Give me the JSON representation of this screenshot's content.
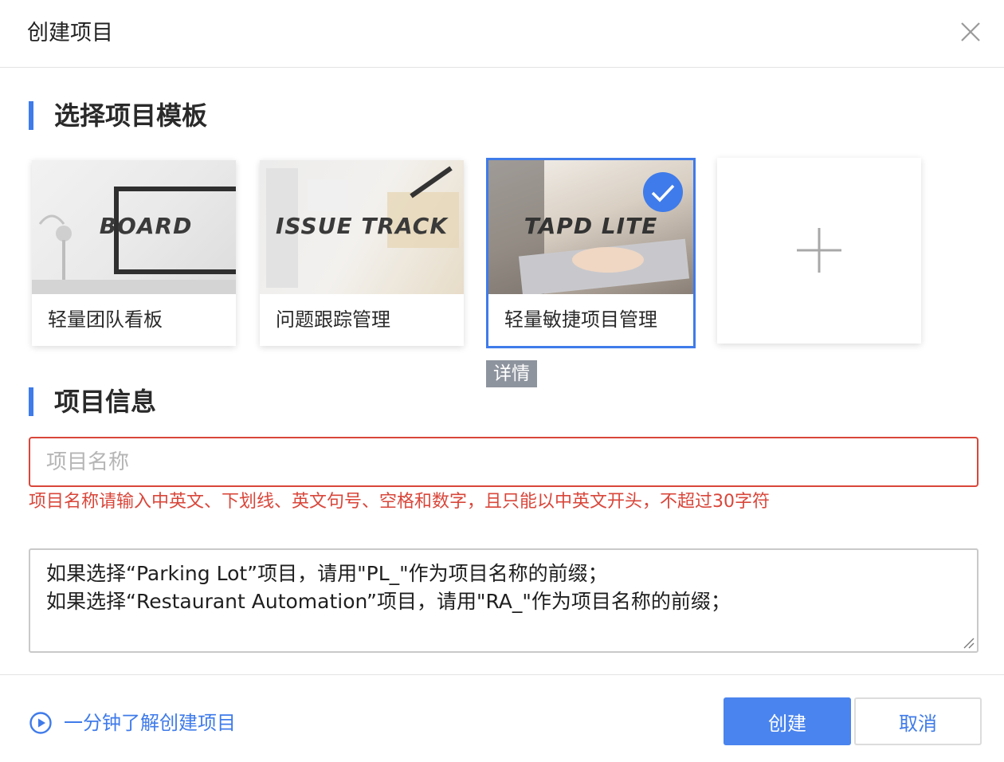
{
  "dialog": {
    "title": "创建项目",
    "close_icon": "close-icon"
  },
  "template_section": {
    "heading": "选择项目模板",
    "templates": [
      {
        "image_text": "BOARD",
        "label": "轻量团队看板",
        "selected": false
      },
      {
        "image_text": "ISSUE TRACK",
        "label": "问题跟踪管理",
        "selected": false
      },
      {
        "image_text": "TAPD LITE",
        "label": "轻量敏捷项目管理",
        "selected": true
      }
    ],
    "add_icon": "plus-icon",
    "detail_label": "详情"
  },
  "info_section": {
    "heading": "项目信息",
    "name_input": {
      "value": "",
      "placeholder": "项目名称"
    },
    "error": "项目名称请输入中英文、下划线、英文句号、空格和数字，且只能以中英文开头，不超过30字符",
    "hint_lines": [
      "如果选择“Parking Lot”项目，请用\"PL_\"作为项目名称的前缀；",
      "如果选择“Restaurant Automation”项目，请用\"RA_\"作为项目名称的前缀；"
    ]
  },
  "footer": {
    "learn_link": "一分钟了解创建项目",
    "play_icon": "play-circle-icon",
    "create_label": "创建",
    "cancel_label": "取消"
  },
  "colors": {
    "accent": "#3f7bea",
    "error": "#d9463a",
    "tag_bg": "#8e949e"
  }
}
